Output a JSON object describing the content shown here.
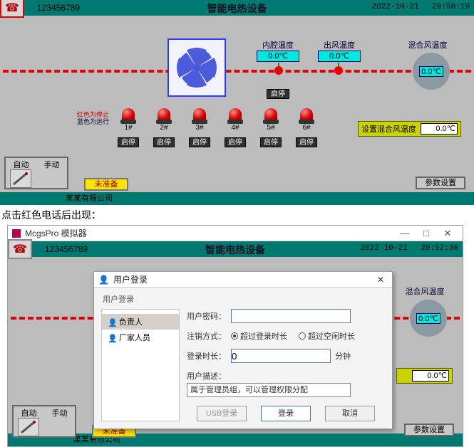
{
  "panel1": {
    "phone_number": "123456789",
    "title": "智能电热设备",
    "date": "2022-10-21",
    "time": "20:50:19",
    "temp_inner": {
      "label": "内腔温度",
      "value": "0.0℃"
    },
    "temp_out": {
      "label": "出风温度",
      "value": "0.0℃"
    },
    "temp_mix": {
      "label": "混合风温度",
      "value": "0.0℃"
    },
    "fan_btn": "启停",
    "red_note_line1": "红色为停止",
    "red_note_line2": "蓝色为运行",
    "heaters": [
      {
        "num": "1#",
        "btn": "启停"
      },
      {
        "num": "2#",
        "btn": "启停"
      },
      {
        "num": "3#",
        "btn": "启停"
      },
      {
        "num": "4#",
        "btn": "启停"
      },
      {
        "num": "5#",
        "btn": "启停"
      },
      {
        "num": "6#",
        "btn": "启停"
      }
    ],
    "set_mix_label": "设置混合风温度",
    "set_mix_value": "0.0℃",
    "mode_auto": "自动",
    "mode_manual": "手动",
    "status": "未准备",
    "param_btn": "参数设置",
    "footer": "某某有限公司"
  },
  "between_caption": "点击红色电话后出现：",
  "sim_window_title": "McgsPro 模拟器",
  "panel2": {
    "phone_number": "123456789",
    "title": "智能电热设备",
    "date": "2022-10-21",
    "time": "20:52:36",
    "temp_mix_label": "混合风温度",
    "temp_mix_value": "0.0℃",
    "set_mix_value": "0.0℃",
    "mode_auto": "自动",
    "mode_manual": "手动",
    "status": "未准备",
    "param_btn": "参数设置",
    "footer": "某某有限公司"
  },
  "login": {
    "title": "用户登录",
    "subtitle": "用户登录",
    "roles": [
      "负责人",
      "厂家人员"
    ],
    "pwd_label": "用户密码：",
    "pwd_value": "",
    "logout_label": "注销方式：",
    "logout_opt1": "超过登录时长",
    "logout_opt2": "超过空闲时长",
    "login_dur_label": "登录时长：",
    "login_dur_value": "0",
    "login_dur_unit": "分钟",
    "desc_label": "用户描述：",
    "desc_value": "属于管理员组，可以管理权限分配",
    "btn_usb": "USB登录",
    "btn_login": "登录",
    "btn_cancel": "取消"
  }
}
